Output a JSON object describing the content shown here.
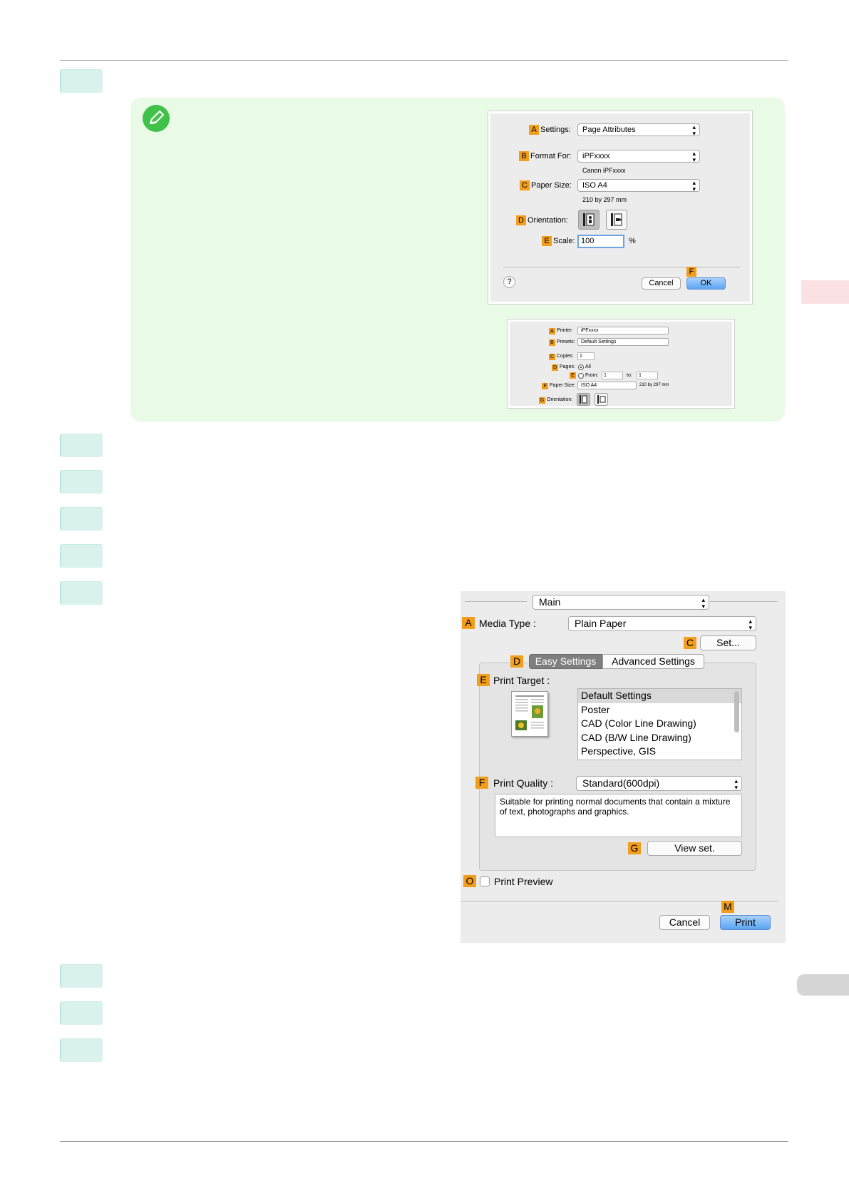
{
  "page_setup_dialog": {
    "settings_badge": "A",
    "settings_label": "Settings:",
    "settings_value": "Page Attributes",
    "format_badge": "B",
    "format_label": "Format For:",
    "format_value": "iPFxxxx",
    "format_sub": "Canon iPFxxxx",
    "paper_badge": "C",
    "paper_label": "Paper Size:",
    "paper_value": "ISO A4",
    "paper_sub": "210 by 297 mm",
    "orientation_badge": "D",
    "orientation_label": "Orientation:",
    "scale_badge": "E",
    "scale_label": "Scale:",
    "scale_value": "100",
    "scale_unit": "%",
    "help_label": "?",
    "cancel_label": "Cancel",
    "ok_badge": "F",
    "ok_label": "OK"
  },
  "print_dialog_small": {
    "printer_badge": "A",
    "printer_label": "Printer:",
    "printer_value": "iPFxxxx",
    "presets_badge": "B",
    "presets_label": "Presets:",
    "presets_value": "Default Settings",
    "copies_badge": "C",
    "copies_label": "Copies:",
    "copies_value": "1",
    "pages_badge": "D",
    "pages_label": "Pages:",
    "pages_all": "All",
    "from_badge": "E",
    "from_label": "From:",
    "from_value": "1",
    "to_label": "to:",
    "to_value": "1",
    "paper_badge": "F",
    "paper_label": "Paper Size:",
    "paper_value": "ISO A4",
    "paper_sub": "210 by 297 mm",
    "orientation_badge": "G",
    "orientation_label": "Orientation:"
  },
  "print_dialog_main": {
    "panel_value": "Main",
    "media_badge": "A",
    "media_label": "Media Type :",
    "media_value": "Plain Paper",
    "set_badge": "C",
    "set_label": "Set...",
    "tabs_badge": "D",
    "tab_easy": "Easy Settings",
    "tab_advanced": "Advanced Settings",
    "target_badge": "E",
    "target_label": "Print Target :",
    "targets": [
      "Default Settings",
      "Poster",
      "CAD (Color Line Drawing)",
      "CAD (B/W Line Drawing)",
      "Perspective, GIS"
    ],
    "quality_badge": "F",
    "quality_label": "Print Quality :",
    "quality_value": "Standard(600dpi)",
    "description": "Suitable for printing normal documents that contain a mixture of text, photographs and graphics.",
    "view_badge": "G",
    "view_label": "View set.",
    "preview_badge": "O",
    "preview_label": "Print Preview",
    "cancel_label": "Cancel",
    "print_badge": "M",
    "print_label": "Print"
  },
  "colors": {
    "note_bg": "#e9fae7",
    "step_bg": "#d9f3ec",
    "badge": "#f29d1c",
    "primary_button": "#5ba5f3"
  }
}
